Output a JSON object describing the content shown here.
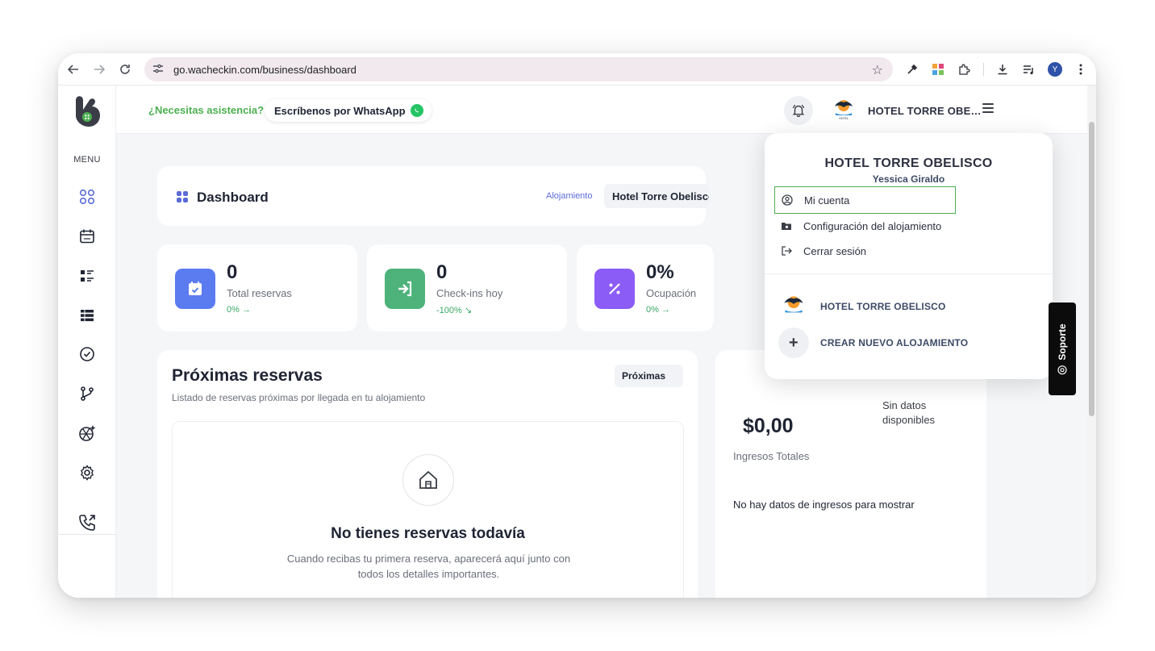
{
  "browser": {
    "url": "go.wacheckin.com/business/dashboard",
    "profile_initial": "Y"
  },
  "sidebar": {
    "menu_label": "MENU"
  },
  "header": {
    "help_text": "¿Necesitas asistencia?",
    "whatsapp_label": "Escríbenos por WhatsApp",
    "hotel_name": "HOTEL TORRE OBE…"
  },
  "dashboard": {
    "title": "Dashboard",
    "alojamiento_label": "Alojamiento",
    "alojamiento_value": "Hotel Torre Obelisco"
  },
  "stats": [
    {
      "value": "0",
      "label": "Total reservas",
      "trend": "0% →",
      "color": "#5b7bf0"
    },
    {
      "value": "0",
      "label": "Check-ins hoy",
      "trend": "-100% ↘",
      "color": "#4db37a"
    },
    {
      "value": "0%",
      "label": "Ocupación",
      "trend": "0% →",
      "color": "#8b5cf6"
    }
  ],
  "reservas": {
    "title": "Próximas reservas",
    "subtitle": "Listado de reservas próximas por llegada en tu alojamiento",
    "filter": "Próximas",
    "empty_title": "No tienes reservas todavía",
    "empty_desc": "Cuando recibas tu primera reserva, aparecerá aquí junto con todos los detalles importantes."
  },
  "ingresos": {
    "sin_datos": "Sin datos disponibles",
    "amount": "$0,00",
    "label": "Ingresos Totales",
    "no_data": "No hay datos de ingresos para mostrar"
  },
  "soporte_label": "Soporte",
  "dropdown": {
    "hotel_title": "HOTEL TORRE OBELISCO",
    "user_name": "Yessica Giraldo",
    "items": [
      {
        "label": "Mi cuenta"
      },
      {
        "label": "Configuración del alojamiento"
      },
      {
        "label": "Cerrar sesión"
      }
    ],
    "hotel_entry": "HOTEL TORRE OBELISCO",
    "create_new": "CREAR NUEVO ALOJAMIENTO"
  },
  "colors": {
    "accent_green": "#4caf50",
    "brand_blue": "#5b6bd8"
  }
}
